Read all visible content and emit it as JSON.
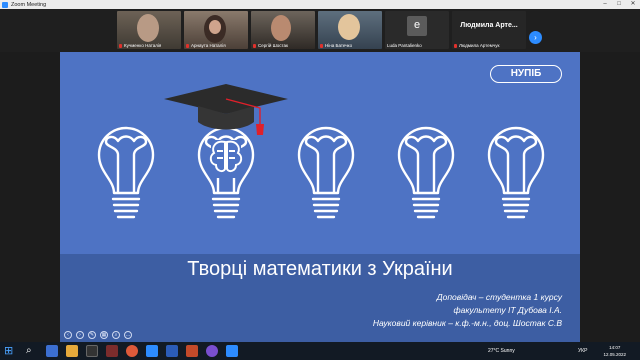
{
  "window": {
    "title": "Zoom Meeting"
  },
  "gallery": {
    "participants": [
      {
        "name": "Кучменко Наталія",
        "muted": true
      },
      {
        "name": "Арнаута Наталія",
        "muted": true
      },
      {
        "name": "Сергій Шостак",
        "muted": true
      },
      {
        "name": "Ніна Батечко",
        "muted": true
      },
      {
        "name": "Luda Pantalienko",
        "muted": false,
        "avatar_letter": "e"
      },
      {
        "name": "Людмила Артемчук",
        "muted": true,
        "display_name": "Людмила Арте..."
      }
    ]
  },
  "slide": {
    "badge": "НУПІБ",
    "title": "Творці математики з України",
    "lines": [
      "Доповідач – студентка 1 курсу",
      "факультету ІТ Дубова І.А.",
      "Науковий керівник – к.ф.-м.н., доц. Шостак С.В"
    ]
  },
  "taskbar": {
    "weather": "27°C  Sunny",
    "lang": "УКР",
    "time": "14:07",
    "date": "12.05.2022"
  },
  "colors": {
    "slide_bg": "#4e73c4",
    "slide_band": "#3d5ea3",
    "zoom_blue": "#2d8cff",
    "tassel": "#e0202a"
  }
}
